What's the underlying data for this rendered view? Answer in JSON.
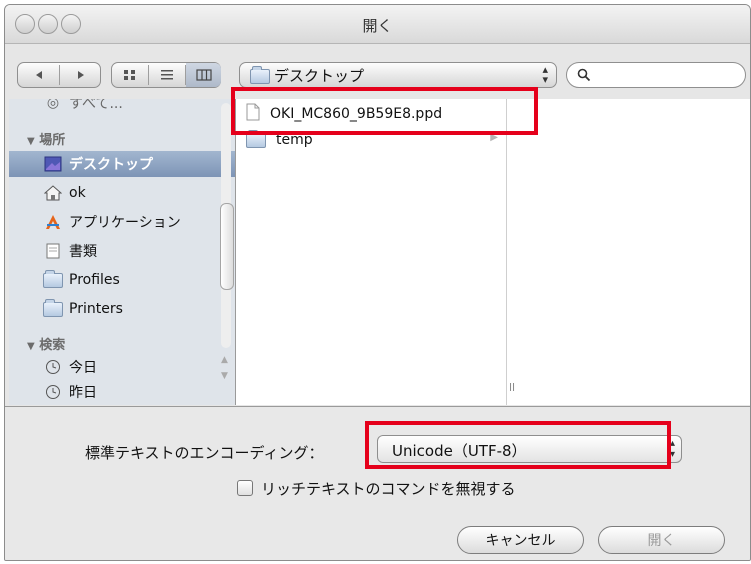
{
  "window": {
    "title": "開く"
  },
  "toolbar": {
    "back_icon": "back-arrow",
    "forward_icon": "forward-arrow",
    "view_modes": [
      "icon-view",
      "list-view",
      "column-view"
    ],
    "location": "デスクトップ",
    "search_value": ""
  },
  "sidebar": {
    "partial_item": "すべて...",
    "places_header": "場所",
    "places": [
      {
        "label": "デスクトップ",
        "icon": "desktop-icon",
        "selected": true
      },
      {
        "label": "ok",
        "icon": "home-icon",
        "selected": false
      },
      {
        "label": "アプリケーション",
        "icon": "applications-icon",
        "selected": false
      },
      {
        "label": "書類",
        "icon": "documents-icon",
        "selected": false
      },
      {
        "label": "Profiles",
        "icon": "folder-icon",
        "selected": false
      },
      {
        "label": "Printers",
        "icon": "folder-icon",
        "selected": false
      }
    ],
    "search_header": "検索",
    "search_items": [
      {
        "label": "今日",
        "icon": "clock-icon"
      },
      {
        "label": "昨日",
        "icon": "clock-icon"
      }
    ]
  },
  "browser": {
    "files": [
      {
        "name": "OKI_MC860_9B59E8.ppd",
        "type": "document",
        "highlighted": true
      },
      {
        "name": "temp",
        "type": "folder",
        "has_children": true
      }
    ]
  },
  "options": {
    "encoding_label": "標準テキストのエンコーディング：",
    "encoding_value": "Unicode（UTF-8）",
    "ignore_rich_label": "リッチテキストのコマンドを無視する",
    "ignore_rich_checked": false
  },
  "buttons": {
    "cancel": "キャンセル",
    "open": "開く"
  },
  "colors": {
    "highlight_box": "#e5001b",
    "sidebar_selection": "#8ea3c2",
    "sidebar_bg": "#dfe4ea"
  }
}
